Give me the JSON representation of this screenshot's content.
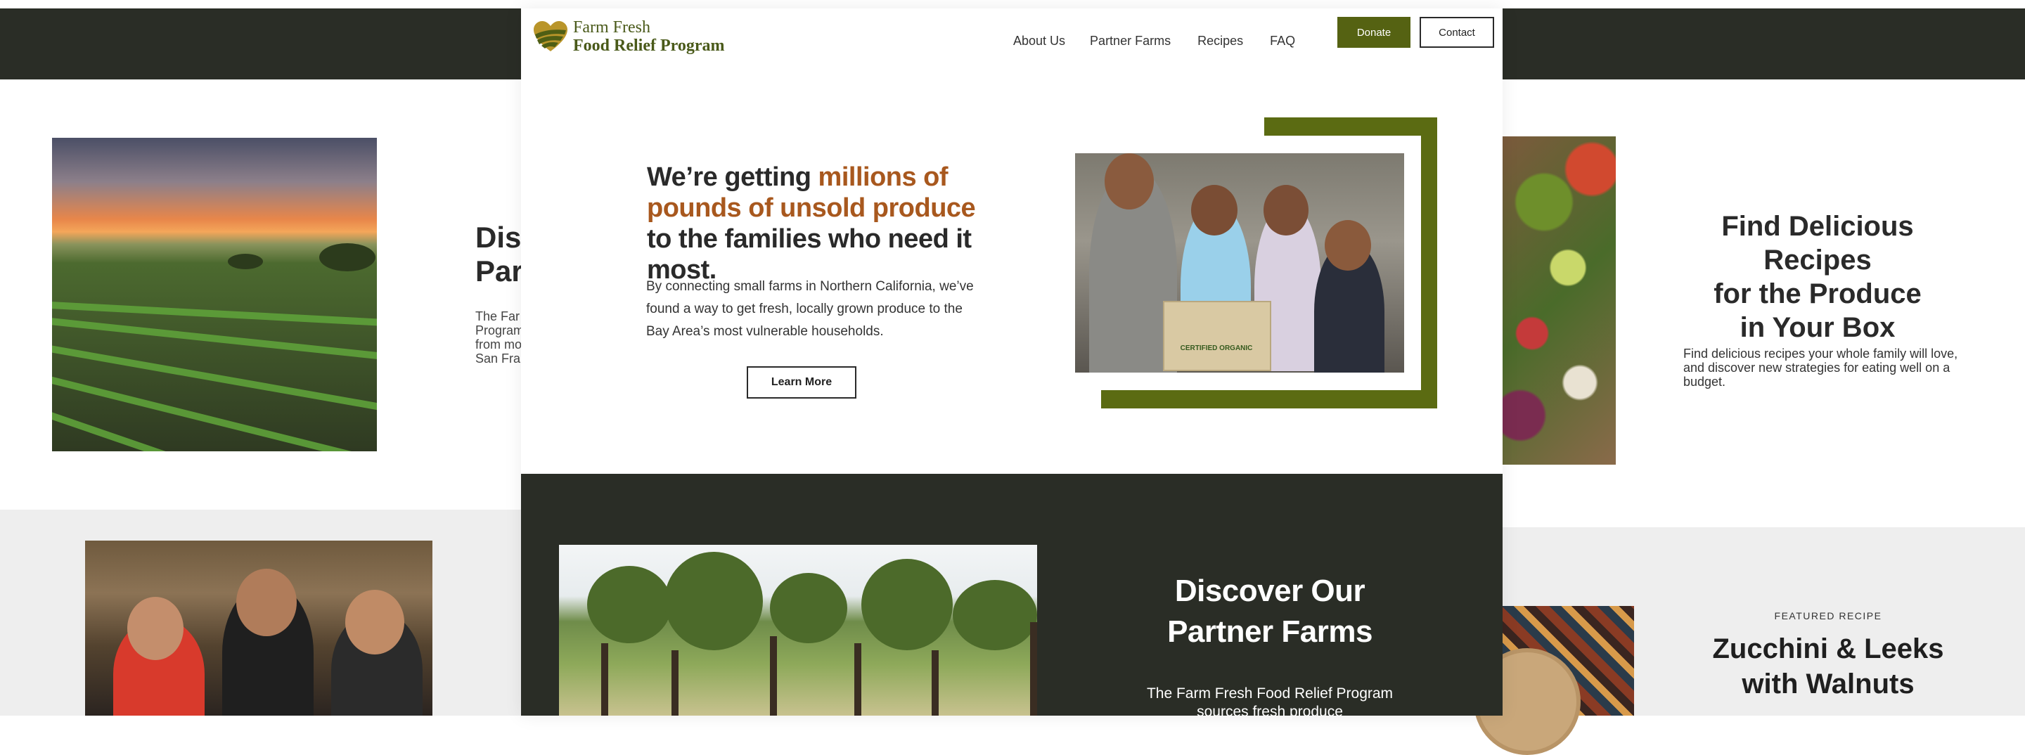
{
  "background_left": {
    "heading": "Discover Our Partner Farms",
    "heading_line1": "Disco",
    "heading_line2": "Part",
    "text_lines": [
      "The Far",
      "Program",
      "from mo",
      "San Fra"
    ]
  },
  "background_right": {
    "recipes_title": [
      "Find Delicious Recipes",
      "for the Produce",
      "in Your Box"
    ],
    "recipes_text": "Find delicious recipes your whole family will love, and discover new strategies for eating well on a budget.",
    "featured_label": "FEATURED RECIPE",
    "featured_title": [
      "Zucchini & Leeks",
      "with Walnuts"
    ]
  },
  "nav": {
    "logo_line1": "Farm Fresh",
    "logo_line2": "Food Relief Program",
    "links": [
      "About Us",
      "Partner Farms",
      "Recipes",
      "FAQ"
    ],
    "donate_label": "Donate",
    "contact_label": "Contact"
  },
  "hero": {
    "heading_part1": "We’re getting ",
    "heading_accent": "millions of pounds of unsold produce",
    "heading_part2": " to the families who need it most.",
    "body": "By connecting small farms in Northern California, we’ve found a way to get fresh, locally grown produce to the Bay Area’s most vulnerable households.",
    "cta_label": "Learn More",
    "box_label": "CERTIFIED ORGANIC"
  },
  "partner_section": {
    "title_line1": "Discover Our",
    "title_line2": "Partner Farms",
    "text": "The Farm Fresh Food Relief Program sources fresh produce"
  },
  "colors": {
    "olive": "#556212",
    "accent_orange": "#a8581e",
    "dark_band": "#2a2d26"
  }
}
